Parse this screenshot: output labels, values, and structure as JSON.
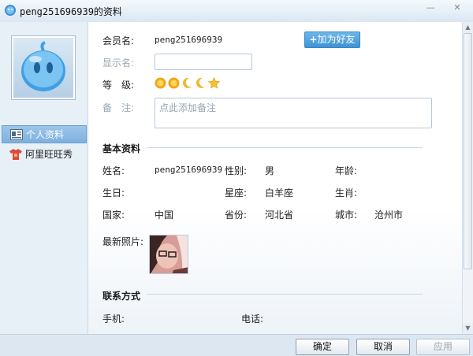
{
  "window": {
    "title": "peng251696939的资料",
    "minimize_glyph": "—",
    "close_glyph": "✕"
  },
  "sidebar": {
    "items": [
      {
        "label": "个人资料",
        "icon": "profile-card-icon"
      },
      {
        "label": "阿里旺旺秀",
        "icon": "tshirt-icon"
      }
    ]
  },
  "profile": {
    "member_label": "会员名:",
    "member_value": "peng251696939",
    "add_friend_label": "加为好友",
    "display_name_label": "显示名:",
    "display_name_value": "",
    "level_label": "等　级:",
    "level_icons": [
      "sun-icon",
      "sun-icon",
      "moon-icon",
      "moon-icon",
      "star-icon"
    ],
    "remark_label": "备　注:",
    "remark_placeholder": "点此添加备注"
  },
  "basic": {
    "section_title": "基本资料",
    "name_label": "姓名:",
    "name_value": "peng251696939",
    "gender_label": "性别:",
    "gender_value": "男",
    "age_label": "年龄:",
    "age_value": "",
    "birthday_label": "生日:",
    "birthday_value": "",
    "constellation_label": "星座:",
    "constellation_value": "白羊座",
    "zodiac_label": "生肖:",
    "zodiac_value": "",
    "country_label": "国家:",
    "country_value": "中国",
    "province_label": "省份:",
    "province_value": "河北省",
    "city_label": "城市:",
    "city_value": "沧州市",
    "photo_label": "最新照片:"
  },
  "contact": {
    "section_title": "联系方式",
    "mobile_label": "手机:",
    "mobile_value": "",
    "phone_label": "电话:",
    "phone_value": ""
  },
  "buttons": {
    "ok": "确定",
    "cancel": "取消",
    "apply": "应用"
  },
  "colors": {
    "accent": "#4a9ad8",
    "nav_active": "#8bbbe4"
  }
}
